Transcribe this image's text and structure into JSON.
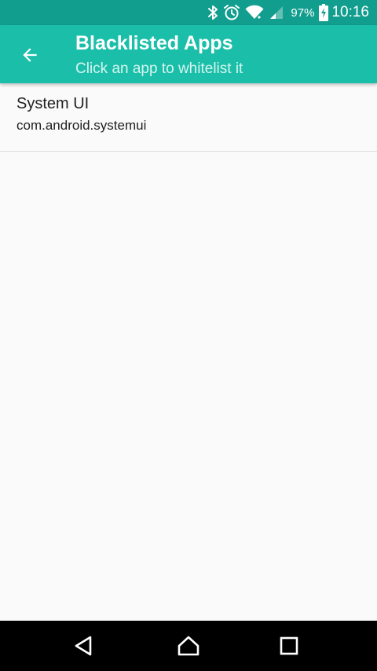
{
  "status_bar": {
    "battery_percent": "97%",
    "time": "10:16",
    "icons": [
      "bluetooth-icon",
      "alarm-icon",
      "wifi-icon",
      "signal-icon",
      "battery-charging-icon"
    ]
  },
  "app_bar": {
    "title": "Blacklisted Apps",
    "subtitle": "Click an app to whitelist it",
    "back_icon": "arrow-back-icon"
  },
  "apps": [
    {
      "name": "System UI",
      "package": "com.android.systemui"
    }
  ],
  "nav_bar": {
    "icons": [
      "back-triangle-icon",
      "home-icon",
      "recents-square-icon"
    ]
  },
  "colors": {
    "status_bar": "#129e8e",
    "app_bar": "#1bbfa9",
    "background": "#fafafa",
    "nav_bar": "#000000"
  }
}
